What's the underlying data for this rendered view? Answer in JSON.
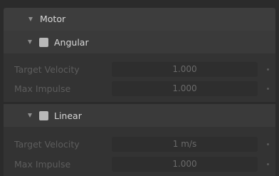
{
  "motor": {
    "title": "Motor",
    "expanded": true,
    "angular": {
      "title": "Angular",
      "enabled": false,
      "expanded": true,
      "target_velocity": {
        "label": "Target Velocity",
        "value": "1.000"
      },
      "max_impulse": {
        "label": "Max Impulse",
        "value": "1.000"
      }
    },
    "linear": {
      "title": "Linear",
      "enabled": false,
      "expanded": true,
      "target_velocity": {
        "label": "Target Velocity",
        "value": "1 m/s"
      },
      "max_impulse": {
        "label": "Max Impulse",
        "value": "1.000"
      }
    }
  },
  "colors": {
    "background": "#2b2b2b",
    "header": "#3d3d3d",
    "field": "#2e2e2e",
    "checkbox": "#b8b8b8",
    "label_disabled": "#5d5d5d",
    "header_text": "#d9d9d9"
  },
  "icons": {
    "expand": "disclosure-triangle-down-icon",
    "keyframe": "keyframe-dot-icon"
  }
}
